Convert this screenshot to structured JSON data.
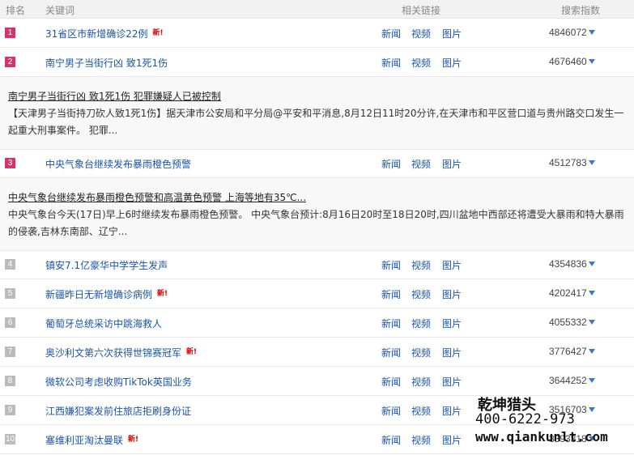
{
  "header": {
    "rank": "排名",
    "keyword": "关键词",
    "links": "相关链接",
    "index": "搜索指数"
  },
  "link_labels": {
    "news": "新闻",
    "video": "视频",
    "image": "图片"
  },
  "new_badge": "新!",
  "rows": [
    {
      "rank": "1",
      "keyword": "31省区市新增确诊22例",
      "is_new": true,
      "index": "4846072"
    },
    {
      "rank": "2",
      "keyword": "南宁男子当街行凶 致1死1伤",
      "is_new": false,
      "index": "4676460"
    },
    {
      "rank": "3",
      "keyword": "中央气象台继续发布暴雨橙色预警",
      "is_new": false,
      "index": "4512783"
    },
    {
      "rank": "4",
      "keyword": "镇安7.1亿豪华中学学生发声",
      "is_new": false,
      "index": "4354836"
    },
    {
      "rank": "5",
      "keyword": "新疆昨日无新增确诊病例",
      "is_new": true,
      "index": "4202417"
    },
    {
      "rank": "6",
      "keyword": "葡萄牙总统采访中跳海救人",
      "is_new": false,
      "index": "4055332"
    },
    {
      "rank": "7",
      "keyword": "奥沙利文第六次获得世锦赛冠军",
      "is_new": true,
      "index": "3776427"
    },
    {
      "rank": "8",
      "keyword": "微软公司考虑收购TikTok英国业务",
      "is_new": false,
      "index": "3644252"
    },
    {
      "rank": "9",
      "keyword": "江西嫌犯案发前住旅店拒刷身份证",
      "is_new": false,
      "index": "3516703"
    },
    {
      "rank": "10",
      "keyword": "塞维利亚淘汰曼联",
      "is_new": true,
      "index": "3393318"
    }
  ],
  "details": [
    {
      "title": "南宁男子当街行凶 致1死1伤 犯罪嫌疑人已被控制",
      "desc": "【天津男子当街持刀砍人致1死1伤】据天津市公安局和平分局@平安和平消息,8月12日11时20分许,在天津市和平区营口道与贵州路交口发生一起重大刑事案件。 犯罪..."
    },
    {
      "title": "中央气象台继续发布暴雨橙色预警和高温黄色预警 上海等地有35℃...",
      "desc": "中央气象台今天(17日)早上6时继续发布暴雨橙色预警。 中央气象台预计:8月16日20时至18日20时,四川盆地中西部还将遭受大暴雨和特大暴雨的侵袭,吉林东南部、辽宁..."
    }
  ],
  "watermark": {
    "name": "乾坤猎头",
    "phone": "400-6222-973",
    "url": "www.qiankunlt.com"
  }
}
